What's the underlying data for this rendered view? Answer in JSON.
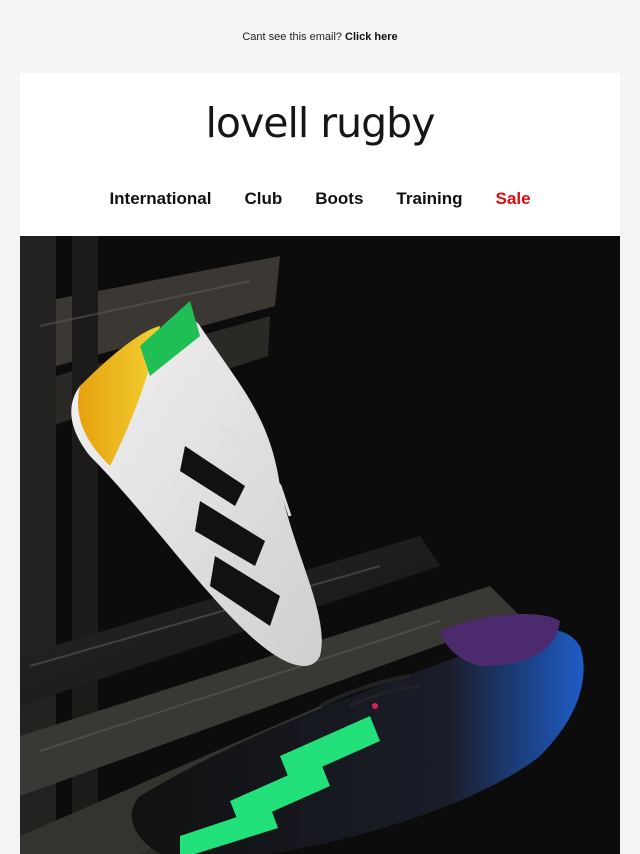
{
  "preheader": {
    "text": "Cant see this email?",
    "link_label": "Click here"
  },
  "brand": {
    "logo_text": "lovell rugby"
  },
  "nav": {
    "items": [
      {
        "label": "International"
      },
      {
        "label": "Club"
      },
      {
        "label": "Boots"
      },
      {
        "label": "Training"
      },
      {
        "label": "Sale",
        "color": "#e00a0a"
      }
    ]
  },
  "hero": {
    "icon": "rugby-boots-image"
  }
}
